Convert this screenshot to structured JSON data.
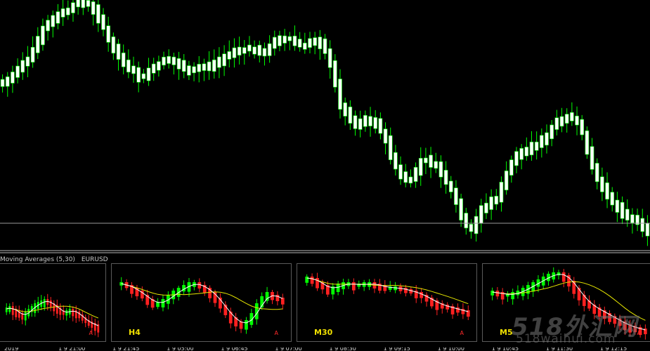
{
  "colors": {
    "background": "#000000",
    "bull": "#00ff00",
    "bear": "#ff2020",
    "main_candle_body": "#ffffff",
    "main_candle_wick": "#00ff00",
    "fast_ma": "#ffffff",
    "slow_ma": "#e6e600",
    "price_line": "#9a9a9a"
  },
  "main_chart": {
    "price_series": [
      118,
      114,
      108,
      100,
      92,
      84,
      70,
      56,
      40,
      34,
      26,
      20,
      18,
      14,
      6,
      4,
      4,
      6,
      14,
      26,
      40,
      56,
      68,
      80,
      88,
      96,
      102,
      110,
      108,
      102,
      96,
      90,
      88,
      86,
      88,
      92,
      96,
      100,
      98,
      96,
      96,
      94,
      90,
      86,
      82,
      78,
      74,
      72,
      70,
      70,
      72,
      74,
      72,
      66,
      60,
      58,
      56,
      56,
      60,
      64,
      64,
      60,
      60,
      62,
      72,
      90,
      120,
      150,
      160,
      170,
      178,
      176,
      170,
      172,
      176,
      186,
      200,
      222,
      238,
      250,
      254,
      256,
      244,
      230,
      228,
      232,
      236,
      248,
      260,
      270,
      288,
      306,
      322,
      326,
      312,
      300,
      294,
      286,
      282,
      266,
      246,
      232,
      222,
      216,
      214,
      210,
      206,
      200,
      192,
      182,
      172,
      168,
      166,
      168,
      176,
      190,
      212,
      236,
      254,
      268,
      280,
      290,
      296,
      304,
      310,
      314,
      318,
      322,
      330
    ]
  },
  "indicator": {
    "name": "Moving Averages (5,30)",
    "symbol": "EURUSD",
    "panels": [
      {
        "label": "",
        "marker": "A",
        "series": [
          58,
          56,
          60,
          62,
          66,
          68,
          64,
          60,
          56,
          52,
          50,
          48,
          46,
          48,
          52,
          54,
          58,
          62,
          64,
          62,
          60,
          62,
          64,
          68,
          72,
          76,
          78,
          80,
          82,
          84
        ]
      },
      {
        "label": "H4",
        "marker": "A",
        "series": [
          22,
          26,
          30,
          34,
          40,
          46,
          50,
          50,
          46,
          40,
          34,
          30,
          26,
          22,
          22,
          26,
          30,
          36,
          44,
          54,
          64,
          72,
          78,
          80,
          76,
          66,
          52,
          42,
          36,
          40,
          44,
          46
        ]
      },
      {
        "label": "M30",
        "marker": "A",
        "series": [
          14,
          16,
          22,
          26,
          30,
          28,
          24,
          22,
          22,
          24,
          24,
          22,
          22,
          24,
          26,
          28,
          28,
          28,
          30,
          32,
          34,
          36,
          40,
          44,
          48,
          52,
          54,
          56,
          58,
          60,
          62,
          64
        ]
      },
      {
        "label": "M5",
        "marker": "A",
        "series": [
          34,
          36,
          38,
          38,
          36,
          34,
          30,
          26,
          22,
          18,
          14,
          10,
          8,
          8,
          12,
          20,
          30,
          40,
          48,
          54,
          58,
          62,
          66,
          70,
          74,
          78,
          82,
          84,
          86,
          88,
          90
        ]
      }
    ]
  },
  "time_axis": {
    "labels": [
      "2019",
      "1 9 21:00",
      "1 9 21:45",
      "1 9 05:00",
      "1 9 06:45",
      "1 9 07:00",
      "1 9 08:30",
      "1 9 09:15",
      "1 9 10:00",
      "1 9 10:45",
      "1 9 11:30",
      "1 9 12:15"
    ]
  },
  "watermark": {
    "title": "518外汇网",
    "url": "518waihui.com"
  }
}
